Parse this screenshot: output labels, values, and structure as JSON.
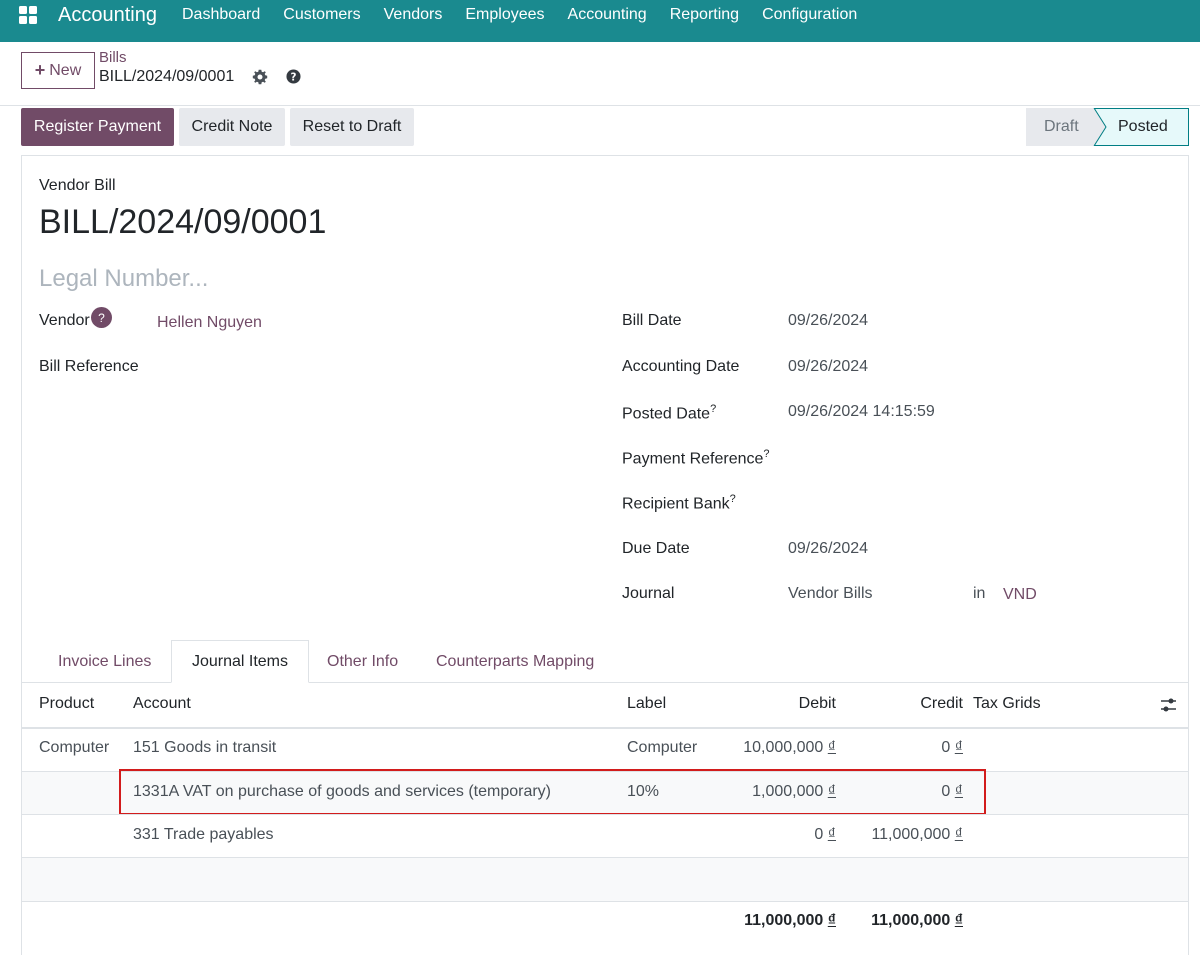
{
  "topbar": {
    "app_name": "Accounting",
    "menu": [
      "Dashboard",
      "Customers",
      "Vendors",
      "Employees",
      "Accounting",
      "Reporting",
      "Configuration"
    ],
    "bg_color": "#1a8a8f"
  },
  "control_panel": {
    "new_label": "New",
    "breadcrumb_parent": "Bills",
    "breadcrumb_current": "BILL/2024/09/0001"
  },
  "actions": {
    "register_payment": "Register Payment",
    "credit_note": "Credit Note",
    "reset_to_draft": "Reset to Draft"
  },
  "status": {
    "draft": "Draft",
    "posted": "Posted",
    "current": "Posted"
  },
  "document": {
    "type": "Vendor Bill",
    "name": "BILL/2024/09/0001",
    "legal_placeholder": "Legal Number..."
  },
  "fields": {
    "vendor_label": "Vendor",
    "vendor_help": "?",
    "vendor_value": "Hellen Nguyen",
    "bill_reference_label": "Bill Reference",
    "bill_date_label": "Bill Date",
    "bill_date_value": "09/26/2024",
    "accounting_date_label": "Accounting Date",
    "accounting_date_value": "09/26/2024",
    "posted_date_label": "Posted Date",
    "posted_date_value": "09/26/2024 14:15:59",
    "payment_reference_label": "Payment Reference",
    "recipient_bank_label": "Recipient Bank",
    "due_date_label": "Due Date",
    "due_date_value": "09/26/2024",
    "journal_label": "Journal",
    "journal_value": "Vendor Bills",
    "journal_in": "in",
    "currency_value": "VND",
    "help_mark": "?"
  },
  "tabs": [
    "Invoice Lines",
    "Journal Items",
    "Other Info",
    "Counterparts Mapping"
  ],
  "table": {
    "headers": [
      "Product",
      "Account",
      "Label",
      "Debit",
      "Credit",
      "Tax Grids"
    ],
    "rows": [
      {
        "product": "Computer",
        "account": "151 Goods in transit",
        "label": "Computer",
        "debit": "10,000,000",
        "credit": "0"
      },
      {
        "product": "",
        "account": "1331A VAT on purchase of goods and services (temporary)",
        "label": "10%",
        "debit": "1,000,000",
        "credit": "0"
      },
      {
        "product": "",
        "account": "331 Trade payables",
        "label": "",
        "debit": "0",
        "credit": "11,000,000"
      }
    ],
    "currency_symbol": "₫",
    "total_debit": "11,000,000",
    "total_credit": "11,000,000"
  }
}
